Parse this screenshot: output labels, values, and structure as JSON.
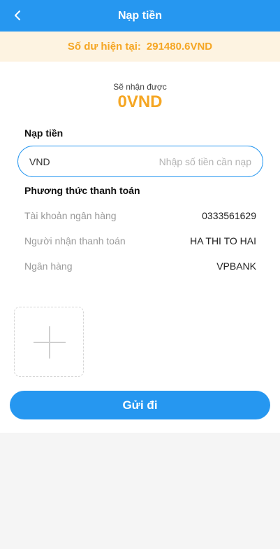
{
  "header": {
    "title": "Nạp tiền"
  },
  "balance": {
    "label": "Số dư hiện tại:",
    "amount": "291480.6VND"
  },
  "receive": {
    "label": "Sẽ nhận được",
    "amount": "0VND"
  },
  "deposit": {
    "section_title": "Nạp tiền",
    "currency": "VND",
    "placeholder": "Nhập số tiền cần nạp",
    "value": ""
  },
  "payment": {
    "section_title": "Phương thức thanh toán",
    "rows": [
      {
        "label": "Tài khoản ngân hàng",
        "value": "0333561629"
      },
      {
        "label": "Người nhận thanh toán",
        "value": "HA THI TO HAI"
      },
      {
        "label": "Ngân hàng",
        "value": "VPBANK"
      }
    ]
  },
  "upload": {
    "icon": "plus-icon"
  },
  "submit": {
    "label": "Gửi đi"
  },
  "colors": {
    "primary": "#2697f0",
    "accent": "#f5a623",
    "balance_bg": "#fdf3e1"
  }
}
